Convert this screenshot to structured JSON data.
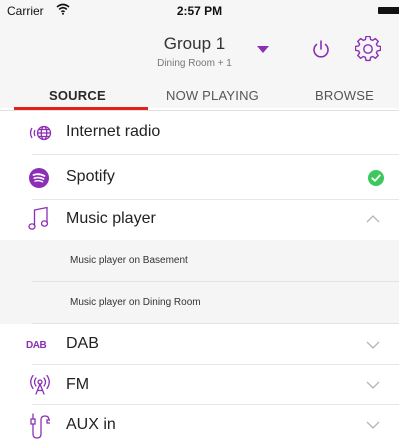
{
  "status_bar": {
    "carrier": "Carrier",
    "time": "2:57 PM"
  },
  "header": {
    "title": "Group 1",
    "subtitle": "Dining Room + 1"
  },
  "tabs": [
    {
      "label": "SOURCE",
      "active": true
    },
    {
      "label": "NOW PLAYING",
      "active": false
    },
    {
      "label": "BROWSE",
      "active": false
    }
  ],
  "sources": [
    {
      "label": "Internet radio",
      "icon": "internet-radio-icon"
    },
    {
      "label": "Spotify",
      "icon": "spotify-icon",
      "status": "check-icon"
    },
    {
      "label": "Music player",
      "icon": "music-note-icon",
      "expanded": true,
      "children": [
        {
          "label": "Music player on Basement"
        },
        {
          "label": "Music player on Dining Room"
        }
      ]
    },
    {
      "label": "DAB",
      "icon": "dab-icon"
    },
    {
      "label": "FM",
      "icon": "fm-icon"
    },
    {
      "label": "AUX in",
      "icon": "aux-in-icon"
    }
  ],
  "colors": {
    "accent_purple": "#8b2fb5",
    "tab_underline": "#e2231a",
    "check_green": "#3cc85e",
    "header_bg": "#f6f6f7"
  }
}
